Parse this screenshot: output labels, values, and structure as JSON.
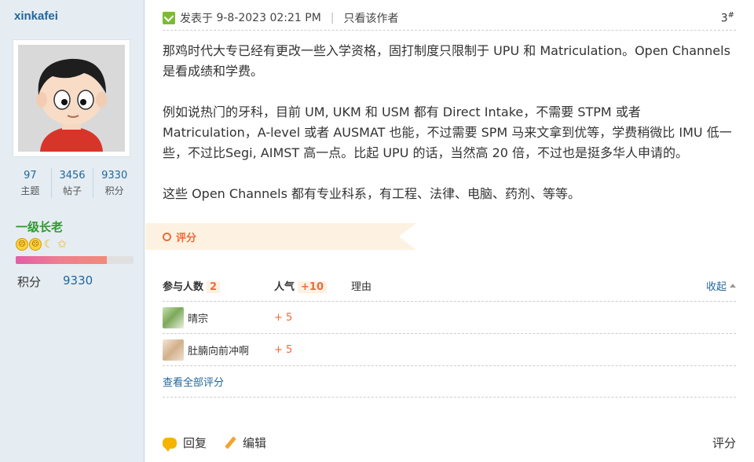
{
  "user": {
    "name": "xinkafei",
    "stats": [
      {
        "num": "97",
        "label": "主题"
      },
      {
        "num": "3456",
        "label": "帖子"
      },
      {
        "num": "9330",
        "label": "积分"
      }
    ],
    "rank": "一级长老",
    "points_label": "积分",
    "points_value": "9330",
    "progress": 0.77,
    "medal_icons": [
      "smiley-icon",
      "smiley-icon",
      "moon-icon",
      "star-icon"
    ]
  },
  "post": {
    "posted_prefix": "发表于",
    "posted_time": "9-8-2023 02:21 PM",
    "author_only": "只看该作者",
    "floor": "3",
    "floor_mark": "#",
    "paragraphs": [
      "那鸡时代大专已经有更改一些入学资格，固打制度只限制于 UPU 和 Matriculation。Open Channels 是看成绩和学费。",
      "例如说热门的牙科，目前 UM, UKM 和 USM 都有 Direct Intake，不需要 STPM 或者 Matriculation，A-level 或者 AUSMAT 也能，不过需要 SPM 马来文拿到优等，学费稍微比 IMU 低一些，不过比Segi, AIMST 高一点。比起 UPU 的话，当然高 20 倍，不过也是挺多华人申请的。",
      "这些 Open Channels 都有专业科系，有工程、法律、电脑、药剂、等等。"
    ]
  },
  "rating": {
    "banner_label": "评分",
    "participants_label": "参与人数",
    "participants_count": "2",
    "popularity_label": "人气",
    "popularity_value": "+10",
    "reason_label": "理由",
    "collapse_label": "收起",
    "rows": [
      {
        "user": "晴宗",
        "score": "+ 5"
      },
      {
        "user": "肚腩向前冲啊",
        "score": "+ 5"
      }
    ],
    "view_all": "查看全部评分"
  },
  "footer": {
    "reply": "回复",
    "edit": "编辑",
    "rate": "评分"
  }
}
